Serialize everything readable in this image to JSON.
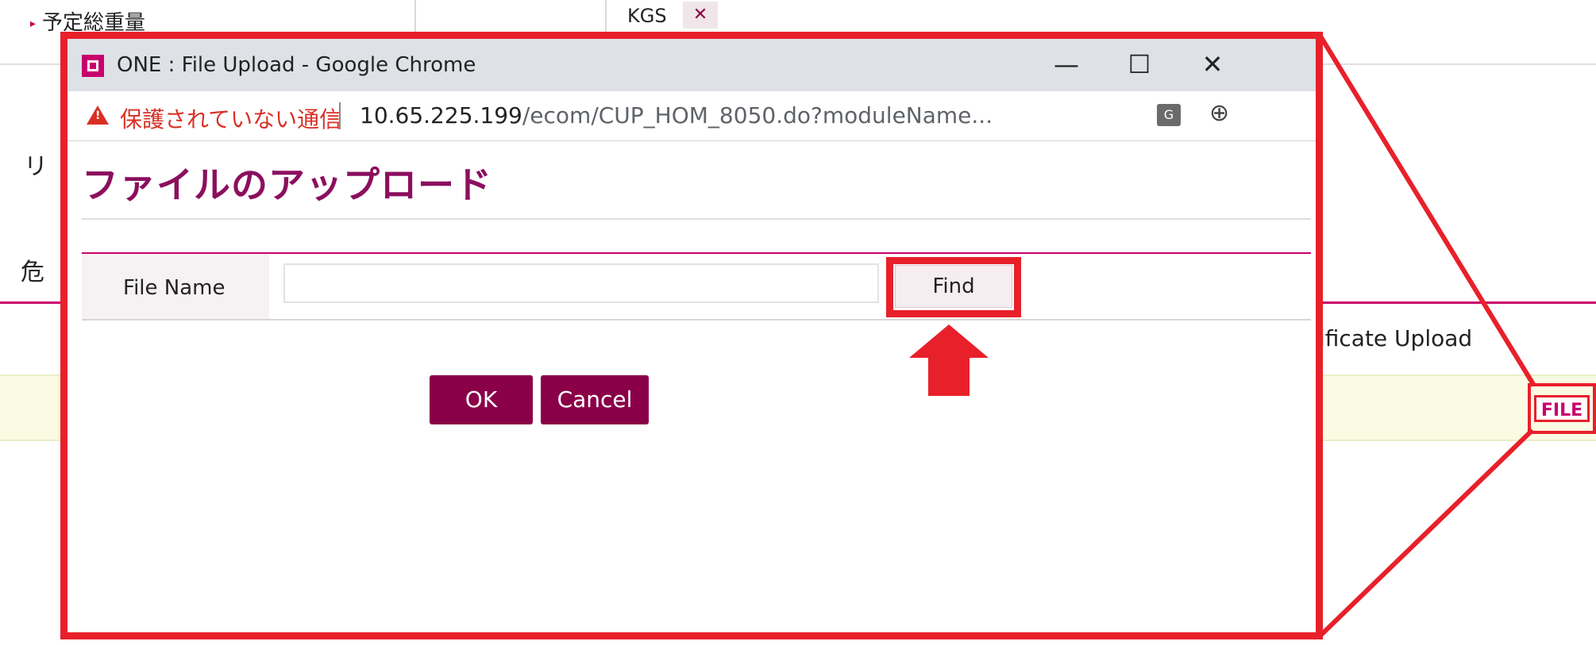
{
  "background": {
    "top_label": "予定総重量",
    "unit": "KGS",
    "unit_caret": "✕",
    "partial_char_1": "リ",
    "partial_char_2": "危",
    "cert_text": "tificate Upload",
    "file_badge": "FILE"
  },
  "window": {
    "title": "ONE : File Upload - Google Chrome",
    "minimize": "—",
    "maximize": "☐",
    "close": "✕"
  },
  "address_bar": {
    "security_label": "保護されていない通信",
    "url_host": "10.65.225.199",
    "url_path": "/ecom/CUP_HOM_8050.do?moduleName...",
    "translate_icon": "G",
    "zoom_icon": "⊕"
  },
  "dialog": {
    "heading": "ファイルのアップロード",
    "file_name_label": "File Name",
    "file_name_value": "",
    "find_label": "Find",
    "ok_label": "OK",
    "cancel_label": "Cancel"
  },
  "colors": {
    "highlight": "#e8202a",
    "brand": "#8a0048",
    "heading": "#8b0f5e"
  }
}
